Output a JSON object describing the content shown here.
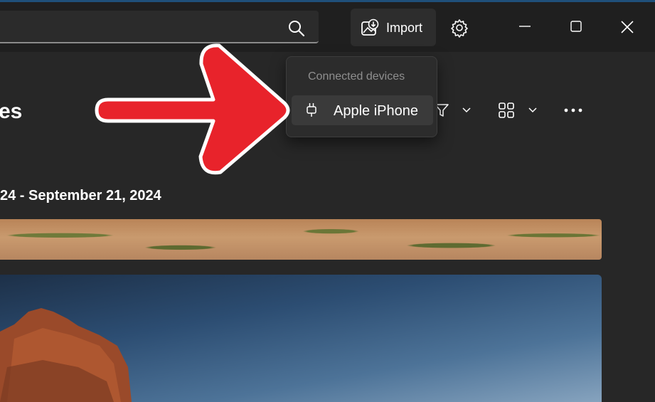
{
  "titlebar": {
    "search": {
      "placeholder": "",
      "icon": "search-icon"
    },
    "import_label": "Import",
    "icons": [
      "import-icon",
      "gear-icon",
      "minimize-icon",
      "maximize-icon",
      "close-icon"
    ]
  },
  "page": {
    "heading_fragment": "es",
    "date_range": "24 - September 21, 2024",
    "toolbar_icons": [
      "filter-icon",
      "chevron-down-icon",
      "layout-icon",
      "chevron-down-icon",
      "more-icon"
    ]
  },
  "flyout": {
    "header": "Connected devices",
    "devices": [
      {
        "label": "Apple iPhone",
        "icon": "usb-plug-icon"
      }
    ]
  },
  "annotation": {
    "arrow_color": "#e8232b",
    "outline_color": "#ffffff"
  }
}
